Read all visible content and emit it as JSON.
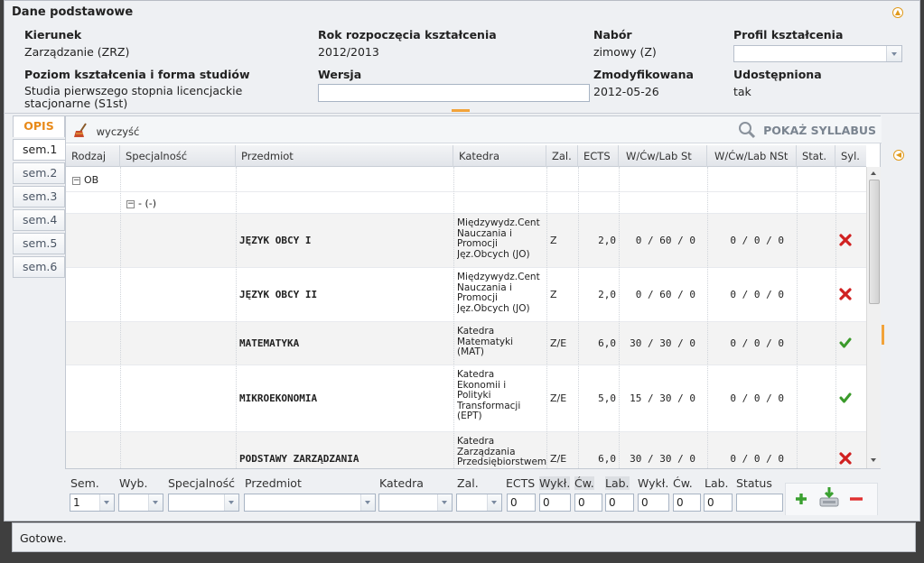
{
  "basic": {
    "title": "Dane podstawowe",
    "kierunek_label": "Kierunek",
    "kierunek_value": "Zarządzanie (ZRZ)",
    "rok_label": "Rok rozpoczęcia kształcenia",
    "rok_value": "2012/2013",
    "nabor_label": "Nabór",
    "nabor_value": "zimowy (Z)",
    "profil_label": "Profil kształcenia",
    "profil_value": "",
    "poziom_label": "Poziom kształcenia i forma studiów",
    "poziom_value": "Studia pierwszego stopnia licencjackie stacjonarne (S1st)",
    "wersja_label": "Wersja",
    "wersja_value": "",
    "zmod_label": "Zmodyfikowana",
    "zmod_value": "2012-05-26",
    "udost_label": "Udostępniona",
    "udost_value": "tak"
  },
  "tabs": {
    "opis": "OPIS",
    "items": [
      "sem.1",
      "sem.2",
      "sem.3",
      "sem.4",
      "sem.5",
      "sem.6"
    ]
  },
  "toolbar": {
    "clear_label": "wyczyść",
    "syllabus_label": "POKAŻ SYLLABUS"
  },
  "table": {
    "columns": [
      "Rodzaj",
      "Specjalność",
      "Przedmiot",
      "Katedra",
      "Zal.",
      "ECTS",
      "W/Ćw/Lab St",
      "W/Ćw/Lab NSt",
      "Stat.",
      "Syl."
    ],
    "group_rodzaj": "OB",
    "group_spec": "- (-)",
    "rows": [
      {
        "przedmiot": "JĘZYK OBCY I",
        "katedra": "Międzywydz.Cent\nNauczania i\nPromocji\nJęz.Obcych (JO)",
        "zal": "Z",
        "ects": "2,0",
        "st": "0 / 60 /  0",
        "nst": "0 /  0 /  0",
        "syl": "no"
      },
      {
        "przedmiot": "JĘZYK OBCY II",
        "katedra": "Międzywydz.Cent\nNauczania i\nPromocji\nJęz.Obcych (JO)",
        "zal": "Z",
        "ects": "2,0",
        "st": "0 / 60 /  0",
        "nst": "0 /  0 /  0",
        "syl": "no"
      },
      {
        "przedmiot": "MATEMATYKA",
        "katedra": "Katedra\nMatematyki\n(MAT)",
        "zal": "Z/E",
        "ects": "6,0",
        "st": "30 / 30 /  0",
        "nst": "0 /  0 /  0",
        "syl": "yes"
      },
      {
        "przedmiot": "MIKROEKONOMIA",
        "katedra": "Katedra\nEkonomii i\nPolityki\nTransformacji\n(EPT)",
        "zal": "Z/E",
        "ects": "5,0",
        "st": "15 / 30 /  0",
        "nst": "0 /  0 /  0",
        "syl": "yes"
      },
      {
        "przedmiot": "PODSTAWY ZARZĄDZANIA",
        "katedra": "Katedra\nZarządzania\nPrzedsiębiorstwem",
        "zal": "Z/E",
        "ects": "6,0",
        "st": "30 / 30 /  0",
        "nst": "0 /  0 /  0",
        "syl": "no"
      }
    ]
  },
  "editor": {
    "sem_label": "Sem.",
    "sem_value": "1",
    "wyb_label": "Wyb.",
    "spec_label": "Specjalność",
    "przedmiot_label": "Przedmiot",
    "katedra_label": "Katedra",
    "zal_label": "Zal.",
    "ects_label": "ECTS",
    "ects_value": "0",
    "wykl1_label": "Wykł.",
    "wykl1_value": "0",
    "cw1_label": "Ćw.",
    "cw1_value": "0",
    "lab1_label": "Lab.",
    "lab1_value": "0",
    "wykl2_label": "Wykł.",
    "wykl2_value": "0",
    "cw2_label": "Ćw.",
    "cw2_value": "0",
    "lab2_label": "Lab.",
    "lab2_value": "0",
    "status_label": "Status"
  },
  "status": {
    "text": "Gotowe."
  },
  "colors": {
    "accent_orange": "#e88a1a",
    "ok_green": "#3a9a2a",
    "fail_red": "#d02020"
  },
  "icons": {
    "clear": "broom-icon",
    "syllabus": "magnifier-icon",
    "add": "plus-icon",
    "save": "save-icon",
    "remove": "minus-icon",
    "syl_yes": "checkmark-icon",
    "syl_no": "x-mark-icon"
  }
}
